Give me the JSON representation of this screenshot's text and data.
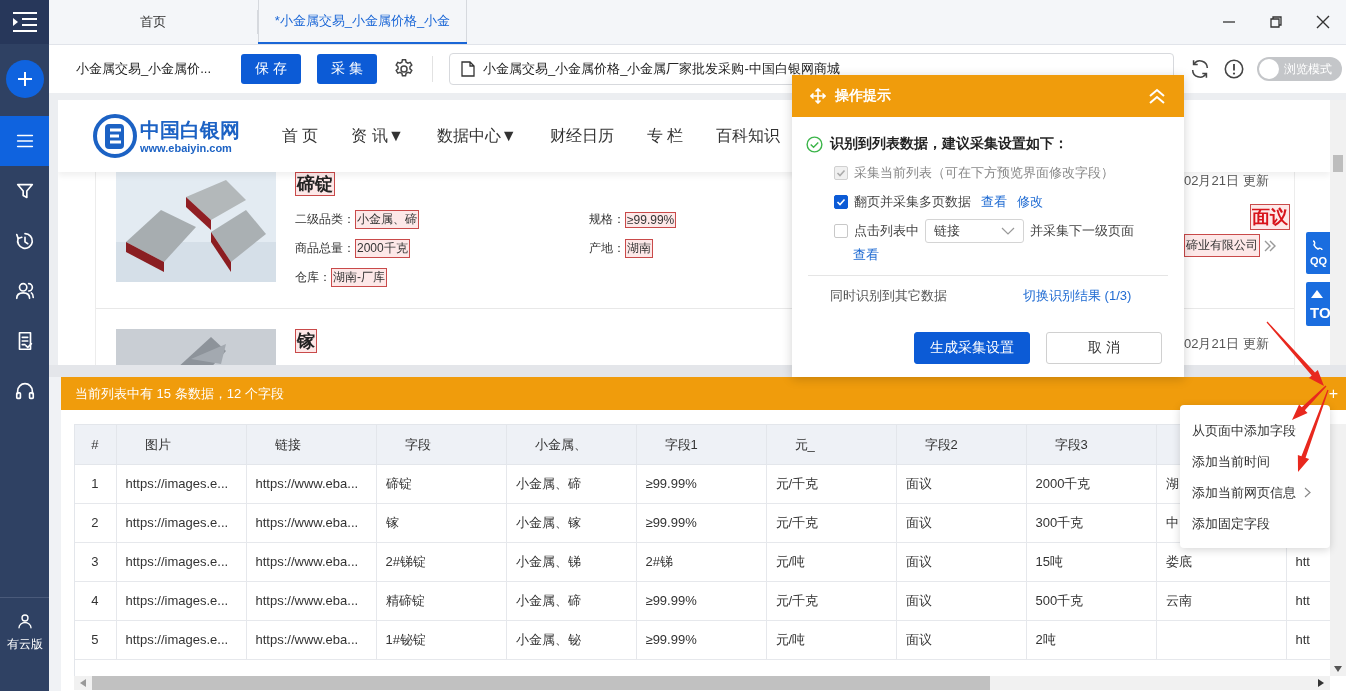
{
  "sidebar": {
    "items": [
      {
        "kind": "list",
        "selected": true
      },
      {
        "kind": "filter",
        "selected": false
      },
      {
        "kind": "history",
        "selected": false
      },
      {
        "kind": "users",
        "selected": false
      },
      {
        "kind": "document",
        "selected": false
      },
      {
        "kind": "support",
        "selected": false
      }
    ],
    "account": {
      "label": "有云版"
    }
  },
  "tabs": [
    {
      "label": "首页",
      "selected": false
    },
    {
      "label": "*小金属交易_小金属价格_小金",
      "selected": true
    }
  ],
  "toolbar": {
    "page_title": "小金属交易_小金属价...",
    "buttons": [
      "保 存",
      "采 集"
    ],
    "url": "小金属交易_小金属价格_小金属厂家批发采购-中国白银网商城",
    "browse_mode": {
      "label": "浏览模式",
      "on": false
    }
  },
  "website": {
    "logo": {
      "name": "中国白银网",
      "url": "www.ebaiyin.com"
    },
    "nav": [
      "首 页",
      "资 讯▼",
      "数据中心▼",
      "财经日历",
      "专 栏",
      "百科知识"
    ],
    "listings": [
      {
        "title": "碲锭",
        "fields": [
          {
            "label": "二级品类：",
            "value": "小金属、碲"
          },
          {
            "label": "规格：",
            "value": "≥99.99%"
          },
          {
            "label": "商品总量：",
            "value": "2000千克"
          },
          {
            "label": "产地：",
            "value": "湖南"
          },
          {
            "label": "仓库：",
            "value": "湖南-厂库"
          }
        ],
        "date": "02月21日 更新",
        "price": "面议",
        "company": "碲业有限公司"
      },
      {
        "title": "镓",
        "date": "02月21日 更新"
      }
    ],
    "float_buttons": [
      "QQ",
      "TO"
    ]
  },
  "guide_popup": {
    "title": "操作提示",
    "heading": "识别到列表数据，建议采集设置如下：",
    "options": [
      {
        "kind": "plain",
        "label": "采集当前列表（可在下方预览界面修改字段）",
        "checked": true,
        "disabled": true
      },
      {
        "kind": "links",
        "label": "翻页并采集多页数据",
        "checked": true,
        "disabled": false,
        "links": [
          "查看",
          "修改"
        ]
      },
      {
        "kind": "select",
        "label": "点击列表中",
        "checked": false,
        "disabled": false,
        "select": "链接",
        "after": "并采集下一级页面",
        "links": [
          "查看"
        ]
      }
    ],
    "other": {
      "label": "同时识别到其它数据",
      "link": "切换识别结果 (1/3)"
    },
    "buttons": [
      {
        "label": "生成采集设置",
        "kind": "primary"
      },
      {
        "label": "取 消",
        "kind": "default"
      }
    ]
  },
  "list_bar": {
    "summary": "当前列表中有 15 条数据，12 个字段",
    "add": "+"
  },
  "table": {
    "columns": [
      "#",
      "图片",
      "链接",
      "字段",
      "小金属、",
      "字段1",
      "元_",
      "字段2",
      "字段3"
    ],
    "rows": [
      [
        "1",
        "https://images.e...",
        "https://www.eba...",
        "碲锭",
        "小金属、碲",
        "≥99.99%",
        "元/千克",
        "面议",
        "2000千克",
        "湖",
        null
      ],
      [
        "2",
        "https://images.e...",
        "https://www.eba...",
        "镓",
        "小金属、镓",
        "≥99.99%",
        "元/千克",
        "面议",
        "300千克",
        "中",
        null
      ],
      [
        "3",
        "https://images.e...",
        "https://www.eba...",
        "2#锑锭",
        "小金属、锑",
        "2#锑",
        "元/吨",
        "面议",
        "15吨",
        "娄底",
        "htt"
      ],
      [
        "4",
        "https://images.e...",
        "https://www.eba...",
        "精碲锭",
        "小金属、碲",
        "≥99.99%",
        "元/千克",
        "面议",
        "500千克",
        "云南",
        "htt"
      ],
      [
        "5",
        "https://images.e...",
        "https://www.eba...",
        "1#铋锭",
        "小金属、铋",
        "≥99.99%",
        "元/吨",
        "面议",
        "2吨",
        null,
        "htt"
      ]
    ]
  },
  "add_field_menu": {
    "items": [
      {
        "label": "从页面中添加字段",
        "submenu": false
      },
      {
        "label": "添加当前时间",
        "submenu": false
      },
      {
        "label": "添加当前网页信息",
        "submenu": true
      },
      {
        "label": "添加固定字段",
        "submenu": false
      }
    ]
  }
}
